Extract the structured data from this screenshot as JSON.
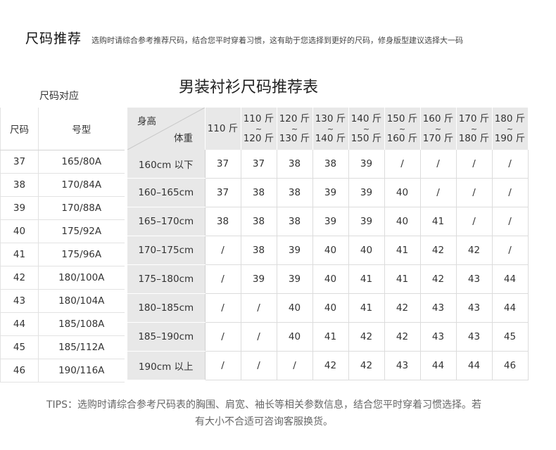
{
  "header": {
    "title": "尺码推荐",
    "subtitle": "选购时请综合参考推荐尺码，结合您平时穿着习惯，这有助于您选择到更好的尺码，修身版型建议选择大一码"
  },
  "chart_title": "男装衬衫尺码推荐表",
  "size_mapping": {
    "caption": "尺码对应",
    "headers": [
      "尺码",
      "号型"
    ],
    "rows": [
      [
        "37",
        "165/80A"
      ],
      [
        "38",
        "170/84A"
      ],
      [
        "39",
        "170/88A"
      ],
      [
        "40",
        "175/92A"
      ],
      [
        "41",
        "175/96A"
      ],
      [
        "42",
        "180/100A"
      ],
      [
        "43",
        "180/104A"
      ],
      [
        "44",
        "185/108A"
      ],
      [
        "45",
        "185/112A"
      ],
      [
        "46",
        "190/116A"
      ]
    ]
  },
  "recommendation": {
    "corner_height": "身高",
    "corner_weight": "体重",
    "tilde": "~",
    "weight_columns": [
      {
        "from": "110 斤",
        "to": ""
      },
      {
        "from": "110 斤",
        "to": "120 斤"
      },
      {
        "from": "120 斤",
        "to": "130 斤"
      },
      {
        "from": "130 斤",
        "to": "140 斤"
      },
      {
        "from": "140 斤",
        "to": "150 斤"
      },
      {
        "from": "150 斤",
        "to": "160 斤"
      },
      {
        "from": "160 斤",
        "to": "170 斤"
      },
      {
        "from": "170 斤",
        "to": "180 斤"
      },
      {
        "from": "180 斤",
        "to": "190 斤"
      }
    ],
    "rows": [
      {
        "height": "160cm 以下",
        "values": [
          "37",
          "37",
          "38",
          "38",
          "39",
          "/",
          "/",
          "/",
          "/"
        ]
      },
      {
        "height": "160–165cm",
        "values": [
          "37",
          "38",
          "38",
          "39",
          "39",
          "40",
          "/",
          "/",
          "/"
        ]
      },
      {
        "height": "165–170cm",
        "values": [
          "38",
          "38",
          "38",
          "39",
          "39",
          "40",
          "41",
          "/",
          "/"
        ]
      },
      {
        "height": "170–175cm",
        "values": [
          "/",
          "38",
          "39",
          "40",
          "40",
          "41",
          "42",
          "42",
          "/"
        ]
      },
      {
        "height": "175–180cm",
        "values": [
          "/",
          "39",
          "39",
          "40",
          "41",
          "41",
          "42",
          "43",
          "44"
        ]
      },
      {
        "height": "180–185cm",
        "values": [
          "/",
          "/",
          "40",
          "40",
          "41",
          "42",
          "43",
          "43",
          "44"
        ]
      },
      {
        "height": "185–190cm",
        "values": [
          "/",
          "/",
          "40",
          "41",
          "42",
          "42",
          "43",
          "43",
          "45"
        ]
      },
      {
        "height": "190cm 以上",
        "values": [
          "/",
          "/",
          "/",
          "42",
          "42",
          "43",
          "44",
          "44",
          "46"
        ]
      }
    ]
  },
  "tips": {
    "line1": "TIPS：选购时请综合参考尺码表的胸围、肩宽、袖长等相关参数信息，结合您平时穿着习惯选择。若",
    "line2": "有大小不合适可咨询客服换货。"
  }
}
